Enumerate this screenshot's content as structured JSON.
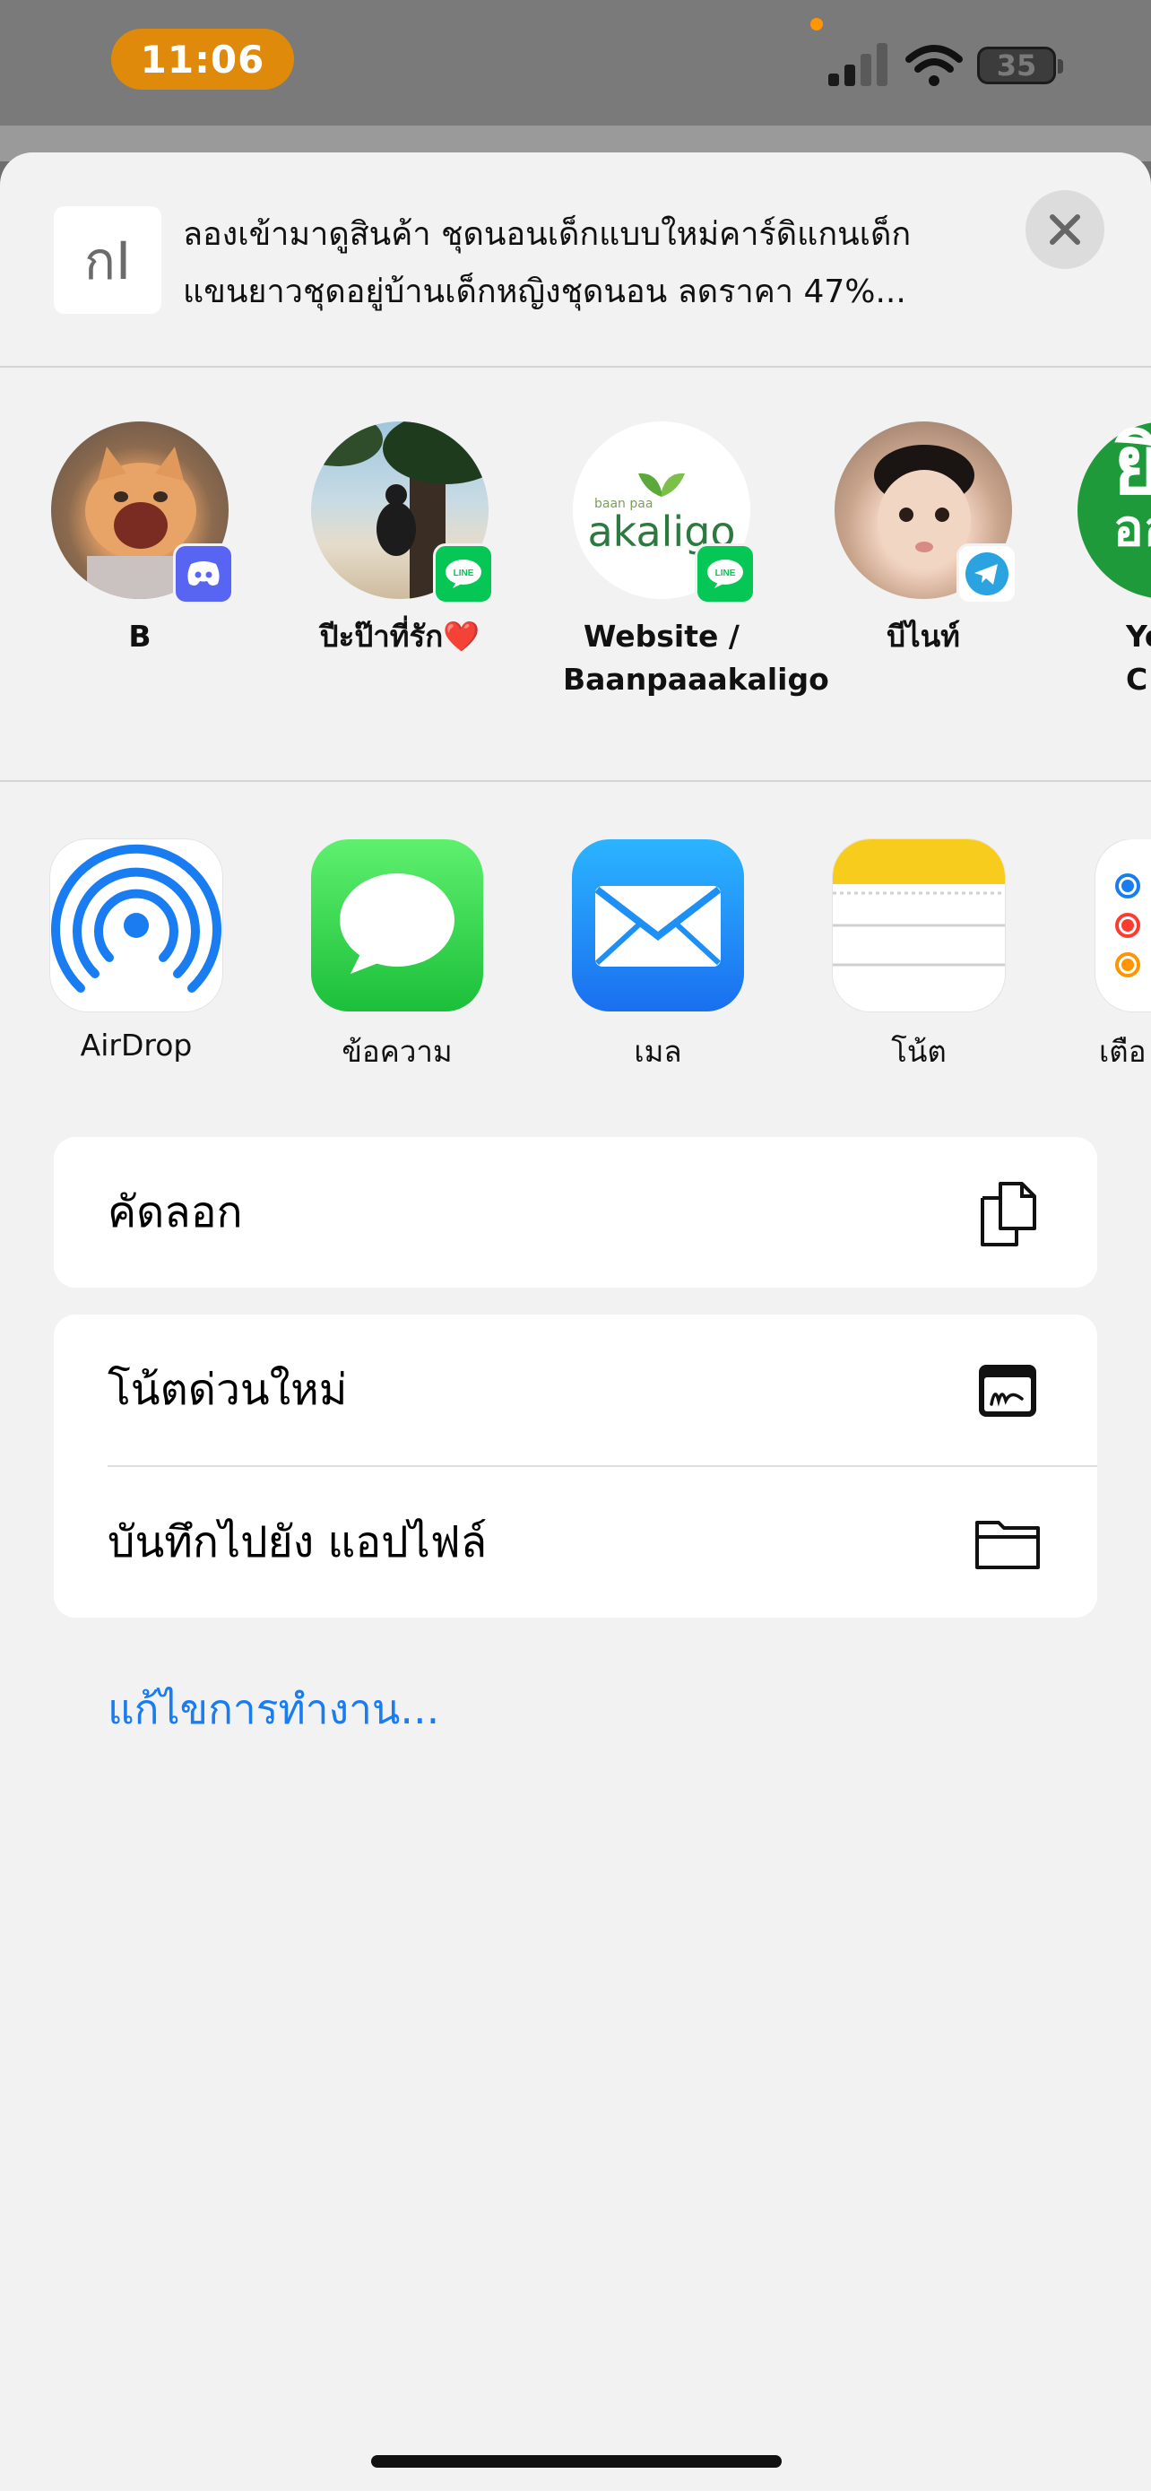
{
  "status_bar": {
    "time": "11:06",
    "battery": "35"
  },
  "preview": {
    "thumb_glyph": "กI",
    "text": "ลองเข้ามาดูสินค้า ชุดนอนเด็กแบบใหม่คาร์ดิแกนเด็กแขนยาวชุดอยู่บ้านเด็กหญิงชุดนอน ลดราคา 47%..."
  },
  "people": [
    {
      "name": "B",
      "badge": "discord-icon"
    },
    {
      "name": "ปีะป๊าที่รัก❤️",
      "badge": "line-icon"
    },
    {
      "name": "Website / Baanpaaakaligo",
      "badge": "line-icon",
      "logo_small": "baan paa",
      "logo": "akaligo"
    },
    {
      "name": "บีไนท์",
      "badge": "telegram-icon"
    },
    {
      "name": "Yo C",
      "glyph": "ยิ",
      "glyph_sub": "ออ"
    }
  ],
  "apps": [
    {
      "label": "AirDrop"
    },
    {
      "label": "ข้อความ"
    },
    {
      "label": "เมล"
    },
    {
      "label": "โน้ต"
    },
    {
      "label": "เตือ"
    }
  ],
  "actions": {
    "copy": "คัดลอก",
    "quick_note": "โน้ตด่วนใหม่",
    "save_to_files": "บันทึกไปยัง แอปไฟล์",
    "edit_actions": "แก้ไขการทำงาน..."
  },
  "colors": {
    "time_pill": "#e08a0c",
    "accent_link": "#1a7cf1",
    "line_green": "#06c755",
    "discord": "#5865f2",
    "telegram": "#2aa3e0"
  }
}
